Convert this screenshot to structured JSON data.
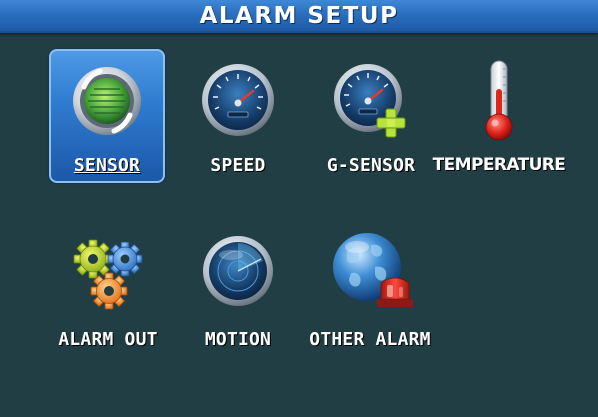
{
  "header": {
    "title": "ALARM SETUP"
  },
  "menu": {
    "items": [
      {
        "id": "sensor",
        "label": "SENSOR",
        "icon": "sensor-icon",
        "selected": true
      },
      {
        "id": "speed",
        "label": "SPEED",
        "icon": "speedometer-icon",
        "selected": false
      },
      {
        "id": "g-sensor",
        "label": "G-SENSOR",
        "icon": "g-sensor-gauge-plus-icon",
        "selected": false
      },
      {
        "id": "temperature",
        "label": "TEMPERATURE",
        "icon": "thermometer-icon",
        "selected": false
      },
      {
        "id": "alarm-out",
        "label": "ALARM OUT",
        "icon": "gears-icon",
        "selected": false
      },
      {
        "id": "motion",
        "label": "MOTION",
        "icon": "radar-icon",
        "selected": false
      },
      {
        "id": "other-alarm",
        "label": "OTHER ALARM",
        "icon": "globe-siren-icon",
        "selected": false
      }
    ]
  },
  "colors": {
    "background": "#203e44",
    "header": "#2a6fbf",
    "selection": "#2f7bd0",
    "label": "#ffffff"
  }
}
